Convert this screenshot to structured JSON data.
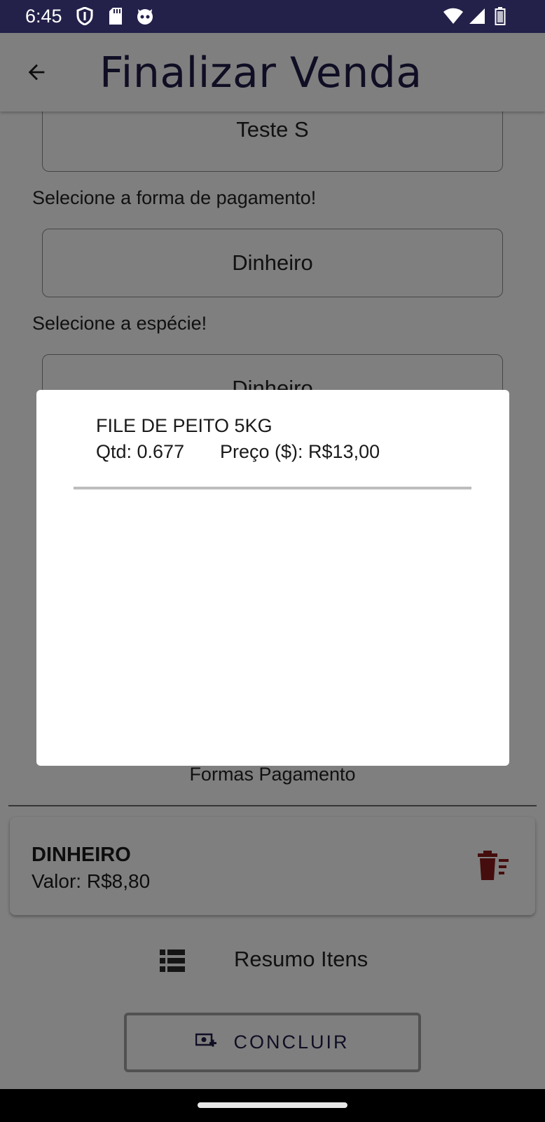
{
  "status_bar": {
    "time": "6:45",
    "left_icons": [
      "shield-icon",
      "sd-card-icon",
      "cat-face-icon"
    ],
    "right_icons": [
      "wifi-icon",
      "cell-signal-icon",
      "battery-icon"
    ]
  },
  "app_bar": {
    "back_icon": "arrow-back-icon",
    "title": "Finalizar Venda"
  },
  "form": {
    "customer_value": "Teste S",
    "payment_method_label": "Selecione a forma de pagamento!",
    "payment_method_value": "Dinheiro",
    "species_label": "Selecione a espécie!",
    "species_value": "Dinheiro"
  },
  "payments_section": {
    "title": "Formas Pagamento",
    "items": [
      {
        "name": "DINHEIRO",
        "value_text": "Valor: R$8,80",
        "delete_icon": "trash-icon",
        "icon_color": "#8b1a1a"
      }
    ]
  },
  "resumo": {
    "icon": "list-icon",
    "label": "Resumo Itens"
  },
  "concluir": {
    "icon": "cash-plus-icon",
    "label": "CONCLUIR"
  },
  "dialog": {
    "items": [
      {
        "name": "FILE DE PEITO 5KG",
        "qtd": "Qtd: 0.677",
        "price": "Preço ($): R$13,00"
      }
    ]
  },
  "colors": {
    "status_bar": "#23214a",
    "title_text": "#1e1c48",
    "scrim": "rgba(0,0,0,0.5)"
  }
}
